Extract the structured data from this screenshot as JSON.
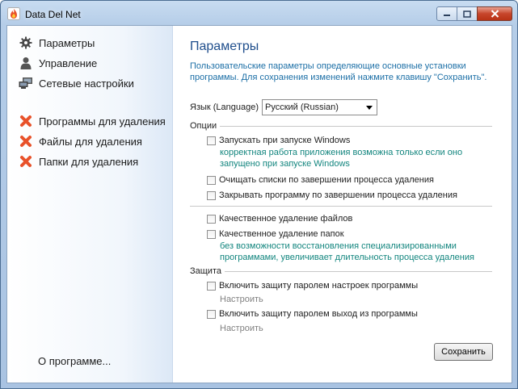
{
  "window": {
    "title": "Data Del Net"
  },
  "sidebar": {
    "items": [
      {
        "label": "Параметры",
        "icon": "gear-icon"
      },
      {
        "label": "Управление",
        "icon": "user-icon"
      },
      {
        "label": "Сетевые настройки",
        "icon": "network-icon"
      },
      {
        "label": "Программы для удаления",
        "icon": "delete-x-icon"
      },
      {
        "label": "Файлы для удаления",
        "icon": "delete-x-icon"
      },
      {
        "label": "Папки для удаления",
        "icon": "delete-x-icon"
      }
    ],
    "about": "О программе..."
  },
  "main": {
    "title": "Параметры",
    "description": "Пользовательские параметры определяющие основные установки программы. Для сохранения изменений нажмите клавишу \"Сохранить\".",
    "language_label": "Язык (Language)",
    "language_value": "Русский (Russian)",
    "options_group": "Опции",
    "options": [
      {
        "label": "Запускать при запуске Windows",
        "note": "корректная работа приложения возможна только если оно запущено при запуске Windows"
      },
      {
        "label": "Очищать списки по завершении процесса удаления"
      },
      {
        "label": "Закрывать программу по завершении процесса удаления"
      },
      {
        "label": "Качественное удаление файлов"
      },
      {
        "label": "Качественное удаление папок",
        "note": "без возможности восстановления специализированными программами, увеличивает длительность процесса удаления"
      }
    ],
    "protection_group": "Защита",
    "protection": [
      {
        "label": "Включить защиту паролем настроек программы",
        "link": "Настроить"
      },
      {
        "label": "Включить защиту паролем выход из программы",
        "link": "Настроить"
      }
    ],
    "save_label": "Сохранить"
  },
  "colors": {
    "heading": "#1f4e8c",
    "description": "#1c6fa6",
    "note": "#12857e",
    "delete_icon": "#e8522a"
  }
}
